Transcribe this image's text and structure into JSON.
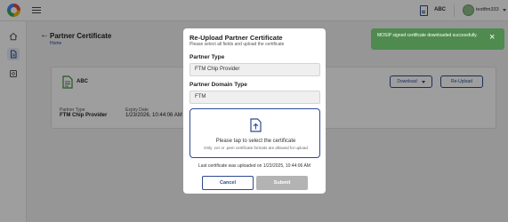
{
  "topbar": {
    "org": "ABC",
    "user": "testftm333"
  },
  "page": {
    "title": "Partner Certificate",
    "breadcrumb": "Home"
  },
  "card": {
    "name": "ABC",
    "partner_type_label": "Partner Type",
    "partner_type_value": "FTM Chip Provider",
    "expiry_label": "Expiry Date",
    "expiry_value": "1/23/2026, 10:44:06 AM",
    "download_label": "Download",
    "reupload_label": "Re-Upload"
  },
  "modal": {
    "title": "Re-Upload Partner Certificate",
    "subtitle": "Please select all fields and upload the certificate",
    "partner_type_label": "Partner Type",
    "partner_type_value": "FTM Chip Provider",
    "domain_label": "Partner Domain Type",
    "domain_value": "FTM",
    "drop_text": "Please tap to select the certificate",
    "drop_hint": "Only .cer or .pem certificate formats are allowed for upload",
    "last_upload": "Last certificate was uploaded on 1/23/2025, 10:44:06 AM",
    "cancel_label": "Cancel",
    "submit_label": "Submit"
  },
  "toast": {
    "message": "MOSIP signed certificate downloaded successfully.",
    "color": "#4f8a4f"
  },
  "colors": {
    "accent": "#2d4a8f",
    "disabled": "#b3b3b3"
  }
}
